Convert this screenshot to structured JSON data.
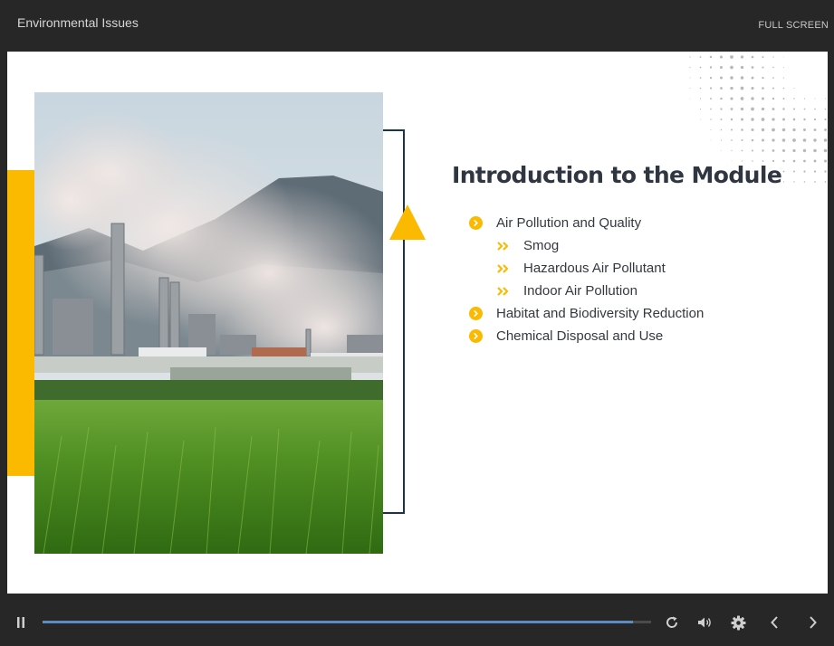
{
  "header": {
    "course_title": "Environmental Issues",
    "fullscreen_label": "FULL SCREEN"
  },
  "slide": {
    "title": "Introduction to the Module",
    "image": "industrial-plant-rice-field-photo",
    "accent_color": "#fbb900",
    "bracket_color": "#1c3448",
    "bullets": [
      {
        "text": "Air Pollution and Quality",
        "level": 1,
        "icon": "circle-chevron-icon"
      },
      {
        "text": "Smog",
        "level": 2,
        "icon": "double-chevron-icon"
      },
      {
        "text": "Hazardous Air Pollutant",
        "level": 2,
        "icon": "double-chevron-icon"
      },
      {
        "text": "Indoor Air Pollution",
        "level": 2,
        "icon": "double-chevron-icon"
      },
      {
        "text": "Habitat and Biodiversity Reduction",
        "level": 1,
        "icon": "circle-chevron-icon"
      },
      {
        "text": "Chemical Disposal and Use",
        "level": 1,
        "icon": "circle-chevron-icon"
      }
    ]
  },
  "player": {
    "progress": 0.97,
    "progress_color": "#5b8cc3",
    "controls": [
      "pause-icon",
      "replay-icon",
      "volume-icon",
      "gear-icon",
      "chevron-left-icon",
      "chevron-right-icon"
    ]
  }
}
